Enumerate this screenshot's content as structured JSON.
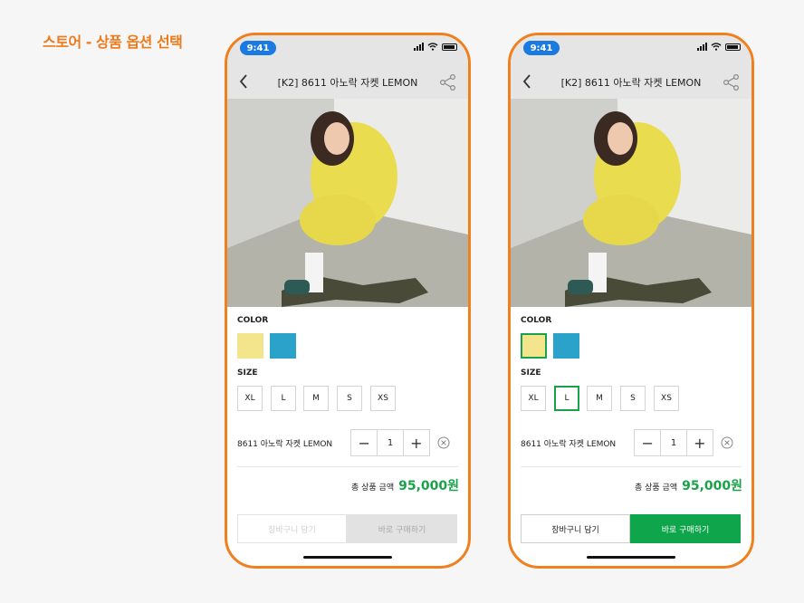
{
  "page_heading": "스토어 - 상품 옵션 선택",
  "colors": {
    "accent_orange": "#f0801e",
    "price_green": "#1aa24a",
    "buy_green": "#0fa54b",
    "swatch_lemon": "#f3e58c",
    "swatch_blue": "#2aa2ca",
    "status_pill_blue": "#1a7ae0"
  },
  "screens": [
    {
      "status": {
        "time": "9:41"
      },
      "header": {
        "title": "[K2] 8611 아노락 자켓  LEMON"
      },
      "options": {
        "color_label": "COLOR",
        "colors": [
          "lemon",
          "blue"
        ],
        "selected_color": null,
        "size_label": "SIZE",
        "sizes": [
          "XL",
          "L",
          "M",
          "S",
          "XS"
        ],
        "selected_size": null
      },
      "selected_item": {
        "name": "8611 아노락 자켓  LEMON",
        "minus": "−",
        "qty": "1",
        "plus": "+"
      },
      "total": {
        "label": "총 상품 금액",
        "price": "95,000원"
      },
      "actions": {
        "cart_label": "장바구니 담기",
        "buy_label": "바로 구매하기",
        "state": "disabled"
      }
    },
    {
      "status": {
        "time": "9:41"
      },
      "header": {
        "title": "[K2] 8611 아노락 자켓  LEMON"
      },
      "options": {
        "color_label": "COLOR",
        "colors": [
          "lemon",
          "blue"
        ],
        "selected_color": "lemon",
        "size_label": "SIZE",
        "sizes": [
          "XL",
          "L",
          "M",
          "S",
          "XS"
        ],
        "selected_size": "L"
      },
      "selected_item": {
        "name": "8611 아노락 자켓  LEMON",
        "minus": "−",
        "qty": "1",
        "plus": "+"
      },
      "total": {
        "label": "총 상품 금액",
        "price": "95,000원"
      },
      "actions": {
        "cart_label": "장바구니 담기",
        "buy_label": "바로 구매하기",
        "state": "active"
      }
    }
  ]
}
